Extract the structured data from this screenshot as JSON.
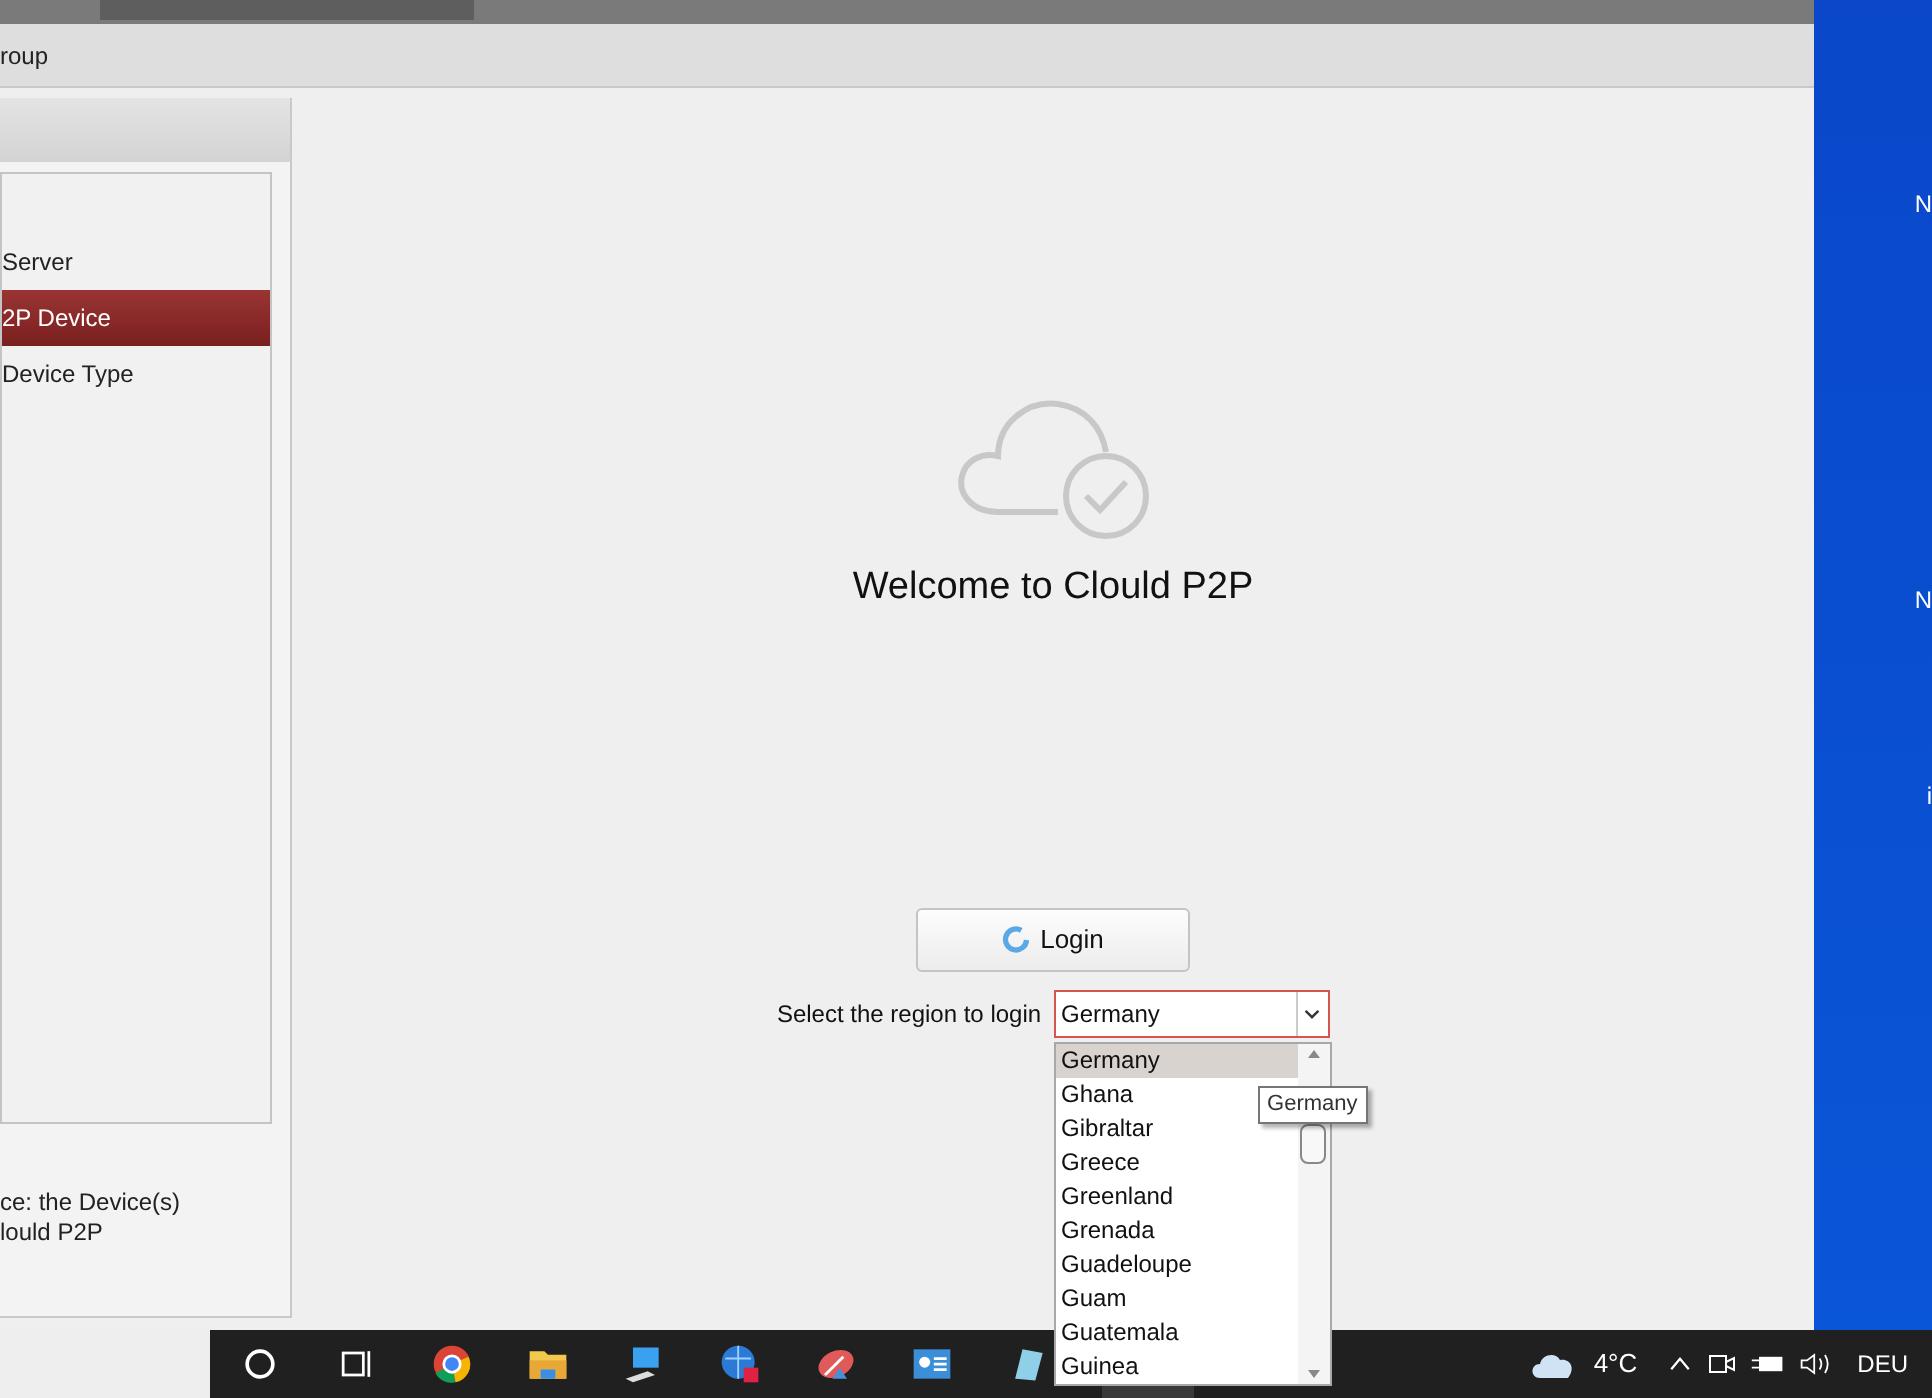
{
  "menu_bar": {
    "label": "roup"
  },
  "sidebar": {
    "items": [
      {
        "label": "Server",
        "selected": false
      },
      {
        "label": "2P Device",
        "selected": true
      },
      {
        "label": "Device Type",
        "selected": false
      }
    ],
    "note_lines": [
      "ce: the Device(s)",
      "lould P2P"
    ]
  },
  "main": {
    "title": "Welcome to Clould P2P",
    "login_button": "Login",
    "region_label": "Select the region to login",
    "region_select": {
      "value": "Germany"
    },
    "dropdown": {
      "options": [
        {
          "label": "Germany",
          "selected": true
        },
        {
          "label": "Ghana",
          "selected": false
        },
        {
          "label": "Gibraltar",
          "selected": false
        },
        {
          "label": "Greece",
          "selected": false
        },
        {
          "label": "Greenland",
          "selected": false
        },
        {
          "label": "Grenada",
          "selected": false
        },
        {
          "label": "Guadeloupe",
          "selected": false
        },
        {
          "label": "Guam",
          "selected": false
        },
        {
          "label": "Guatemala",
          "selected": false
        },
        {
          "label": "Guinea",
          "selected": false
        }
      ]
    },
    "tooltip": "Germany"
  },
  "desktop": {
    "icon_labels": [
      "N",
      "N",
      "i"
    ]
  },
  "taskbar": {
    "weather_temp": "4°C",
    "language": "DEU"
  }
}
